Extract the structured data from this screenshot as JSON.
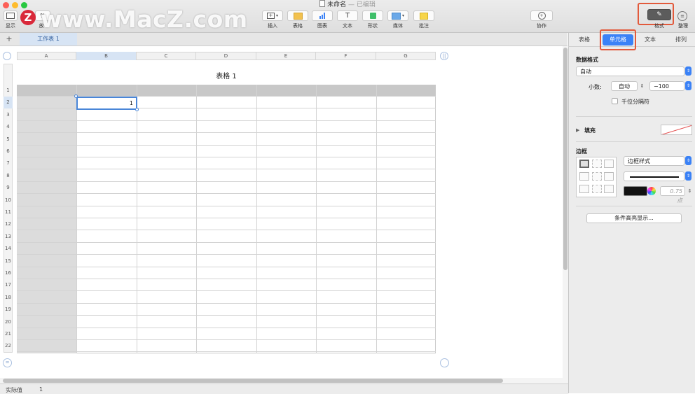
{
  "window": {
    "title": "未命名",
    "subtitle": "— 已编辑"
  },
  "watermark": "www.MacZ.com",
  "watermark_logo": "Z",
  "toolbar": {
    "view_label": "显示",
    "zoom_value": "%",
    "zoom_label": "放",
    "items": [
      {
        "label": "插入",
        "icon": "insert-icon"
      },
      {
        "label": "表格",
        "icon": "table-icon"
      },
      {
        "label": "图表",
        "icon": "chart-icon"
      },
      {
        "label": "文本",
        "icon": "text-icon"
      },
      {
        "label": "形状",
        "icon": "shape-icon"
      },
      {
        "label": "媒体",
        "icon": "media-icon"
      },
      {
        "label": "批注",
        "icon": "comment-icon"
      }
    ],
    "collab_label": "协作",
    "format_label": "格式",
    "organize_label": "整理"
  },
  "sheet_tabs": {
    "add": "+",
    "active": "工作表 1"
  },
  "table": {
    "title": "表格 1",
    "columns": [
      "A",
      "B",
      "C",
      "D",
      "E",
      "F",
      "G"
    ],
    "rows": [
      "1",
      "2",
      "3",
      "4",
      "5",
      "6",
      "7",
      "8",
      "9",
      "10",
      "11",
      "12",
      "13",
      "14",
      "15",
      "16",
      "17",
      "18",
      "19",
      "20",
      "21",
      "22"
    ],
    "selected_cell": "B2",
    "selected_value": "1"
  },
  "sidebar": {
    "tabs": [
      "表格",
      "单元格",
      "文本",
      "排列"
    ],
    "active_tab": "单元格",
    "data_format_title": "数据格式",
    "data_format_value": "自动",
    "decimal_label": "小数:",
    "decimal_value": "自动",
    "negative_value": "−100",
    "thousands_label": "千位分隔符",
    "fill_label": "填充",
    "border_title": "边框",
    "border_style_label": "边框样式",
    "border_width": "0.75 点",
    "conditional_button": "条件高亮显示..."
  },
  "footer": {
    "status_label": "实际值",
    "page": "1"
  },
  "colors": {
    "accent": "#3b82f6",
    "highlight": "#e25a3c",
    "header_fill": "#c8c8c8",
    "sidebar_bg": "#ececec"
  }
}
